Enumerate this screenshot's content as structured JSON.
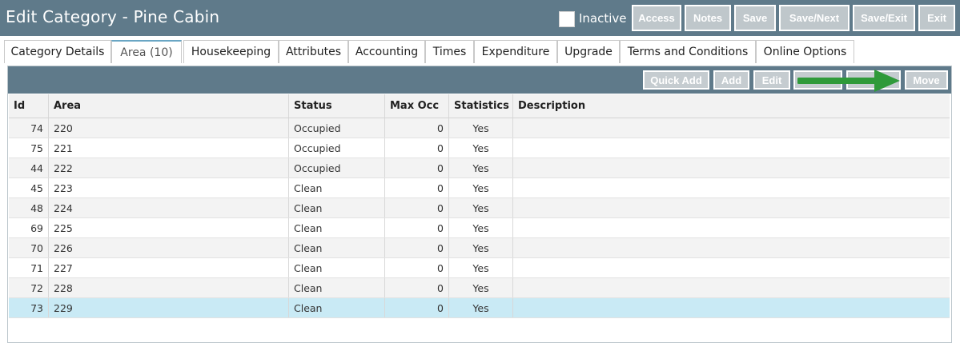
{
  "window": {
    "title": "Edit Category - Pine Cabin",
    "inactive_label": "Inactive"
  },
  "top_buttons": [
    "Access",
    "Notes",
    "Save",
    "Save/Next",
    "Save/Exit",
    "Exit"
  ],
  "tabs": [
    {
      "label": "Category Details"
    },
    {
      "label": "Area (10)",
      "active": true
    },
    {
      "label": "Housekeeping"
    },
    {
      "label": "Attributes"
    },
    {
      "label": "Accounting"
    },
    {
      "label": "Times"
    },
    {
      "label": "Expenditure"
    },
    {
      "label": "Upgrade"
    },
    {
      "label": "Terms and Conditions"
    },
    {
      "label": "Online Options"
    }
  ],
  "panel_buttons": [
    "Quick Add",
    "Add",
    "Edit",
    "",
    "",
    "Move"
  ],
  "grid": {
    "columns": [
      "Id",
      "Area",
      "Status",
      "Max Occ",
      "Statistics",
      "Description"
    ],
    "rows": [
      {
        "id": "74",
        "area": "220",
        "status": "Occupied",
        "max_occ": "0",
        "statistics": "Yes",
        "description": ""
      },
      {
        "id": "75",
        "area": "221",
        "status": "Occupied",
        "max_occ": "0",
        "statistics": "Yes",
        "description": ""
      },
      {
        "id": "44",
        "area": "222",
        "status": "Occupied",
        "max_occ": "0",
        "statistics": "Yes",
        "description": ""
      },
      {
        "id": "45",
        "area": "223",
        "status": "Clean",
        "max_occ": "0",
        "statistics": "Yes",
        "description": ""
      },
      {
        "id": "48",
        "area": "224",
        "status": "Clean",
        "max_occ": "0",
        "statistics": "Yes",
        "description": ""
      },
      {
        "id": "69",
        "area": "225",
        "status": "Clean",
        "max_occ": "0",
        "statistics": "Yes",
        "description": ""
      },
      {
        "id": "70",
        "area": "226",
        "status": "Clean",
        "max_occ": "0",
        "statistics": "Yes",
        "description": ""
      },
      {
        "id": "71",
        "area": "227",
        "status": "Clean",
        "max_occ": "0",
        "statistics": "Yes",
        "description": ""
      },
      {
        "id": "72",
        "area": "228",
        "status": "Clean",
        "max_occ": "0",
        "statistics": "Yes",
        "description": ""
      },
      {
        "id": "73",
        "area": "229",
        "status": "Clean",
        "max_occ": "0",
        "statistics": "Yes",
        "description": "",
        "selected": true
      }
    ]
  },
  "annotation": {
    "icon": "arrow-right-icon",
    "color": "#2f9a3a"
  },
  "colors": {
    "header_bg": "#5f7a8a",
    "selected_row": "#c9eaf5"
  }
}
